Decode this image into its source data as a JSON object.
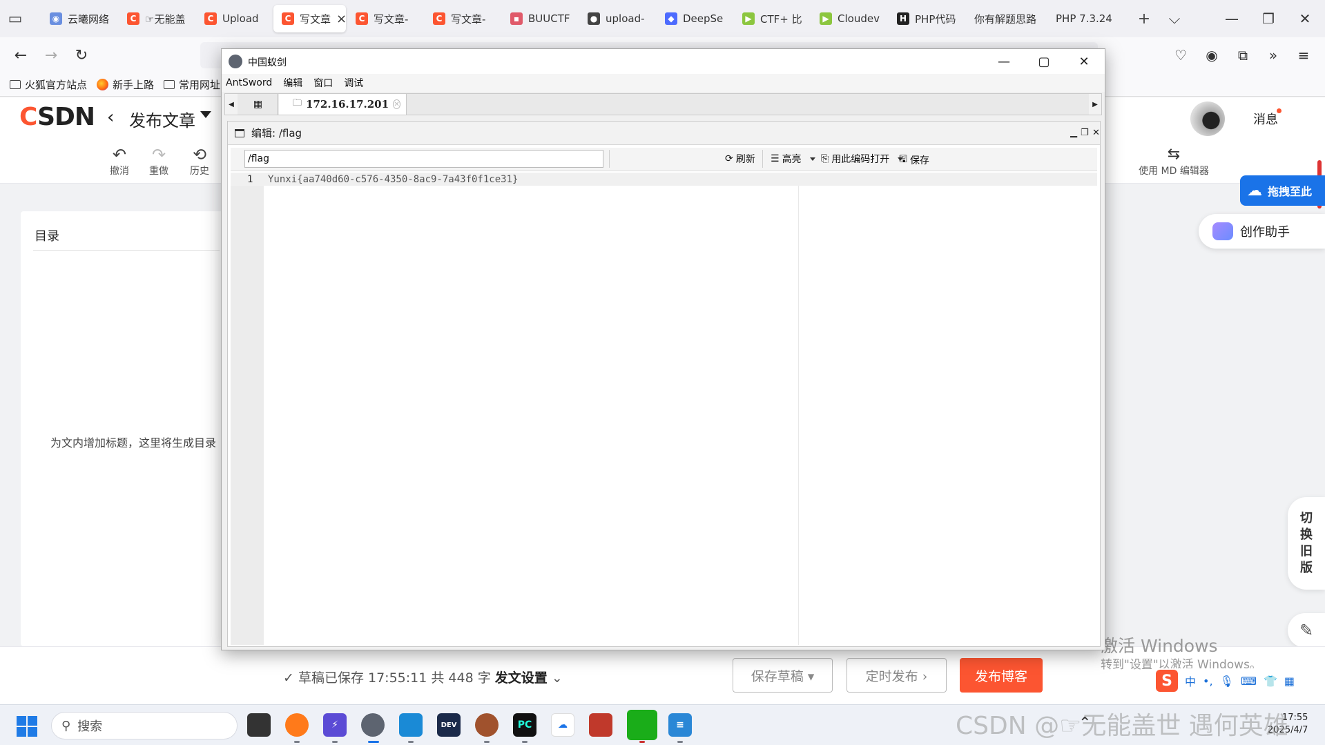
{
  "browser": {
    "tabs": [
      {
        "label": "云曦网络",
        "fav_color": "#6a8fe0",
        "fav_glyph": "◉"
      },
      {
        "label": "☞无能盖",
        "fav_color": "#fc5531",
        "fav_glyph": "C"
      },
      {
        "label": "Upload",
        "fav_color": "#fc5531",
        "fav_glyph": "C"
      },
      {
        "label": "写文章",
        "fav_color": "#fc5531",
        "fav_glyph": "C",
        "active": true
      },
      {
        "label": "写文章-",
        "fav_color": "#fc5531",
        "fav_glyph": "C"
      },
      {
        "label": "写文章-",
        "fav_color": "#fc5531",
        "fav_glyph": "C"
      },
      {
        "label": "BUUCTF",
        "fav_color": "#e05a6a",
        "fav_glyph": "▪"
      },
      {
        "label": "upload-",
        "fav_color": "#444444",
        "fav_glyph": "●"
      },
      {
        "label": "DeepSe",
        "fav_color": "#4d6bfe",
        "fav_glyph": "◆"
      },
      {
        "label": "CTF+ 比",
        "fav_color": "#8cc63f",
        "fav_glyph": "▶"
      },
      {
        "label": "Cloudev",
        "fav_color": "#8cc63f",
        "fav_glyph": "▶"
      },
      {
        "label": "PHP代码",
        "fav_color": "#222222",
        "fav_glyph": "H"
      },
      {
        "label": "你有解题思路",
        "fav_color": "#ffffff",
        "fav_glyph": ""
      },
      {
        "label": "PHP 7.3.24",
        "fav_color": "#ffffff",
        "fav_glyph": ""
      }
    ],
    "new_tab": "+",
    "list_tabs": "⌵"
  },
  "bookmarks": [
    {
      "label": "火狐官方站点",
      "icon": "folder-icon"
    },
    {
      "label": "新手上路",
      "icon": "firefox-icon"
    },
    {
      "label": "常用网址",
      "icon": "folder-icon"
    }
  ],
  "csdn": {
    "logo_c": "C",
    "logo_rest": "SDN",
    "back_glyph": "‹",
    "publish_title": "发布文章",
    "message_label": "消息",
    "toolbar": {
      "undo": "撤消",
      "redo": "重做",
      "history": "历史",
      "md_editor": "使用 MD 编辑器"
    },
    "toc_title": "目录",
    "toc_empty": "为文内增加标题，这里将生成目录",
    "float_drag": "拖拽至此",
    "float_assistant": "创作助手",
    "switch_old": [
      "切",
      "换",
      "旧",
      "版"
    ],
    "save_status_prefix": "✓ 草稿已保存 17:55:11  共 448 字",
    "save_status_settings": "发文设置",
    "btn_draft": "保存草稿 ▾",
    "btn_timed": "定时发布 ›",
    "btn_publish": "发布博客"
  },
  "antsword": {
    "window_title": "中国蚁剑",
    "menu": [
      "AntSword",
      "编辑",
      "窗口",
      "调试"
    ],
    "host_tab": "172.16.17.201",
    "panel_title": "编辑: /flag",
    "path_value": "/flag",
    "toolbar": {
      "refresh": "刷新",
      "highlight": "高亮",
      "open_with_encoding": "用此编码打开",
      "save": "保存"
    },
    "editor": {
      "line_number": "1",
      "content": "Yunxi{aa740d60-c576-4350-8ac9-7a43f0f1ce31}"
    }
  },
  "windows": {
    "activate_title": "激活 Windows",
    "activate_sub": "转到\"设置\"以激活 Windows。",
    "taskbar_search": "搜索",
    "clock_time": "17:55",
    "clock_date": "2025/4/7",
    "watermark": "CSDN @☞无能盖世 遇何英雄",
    "ime_cn": "中"
  }
}
